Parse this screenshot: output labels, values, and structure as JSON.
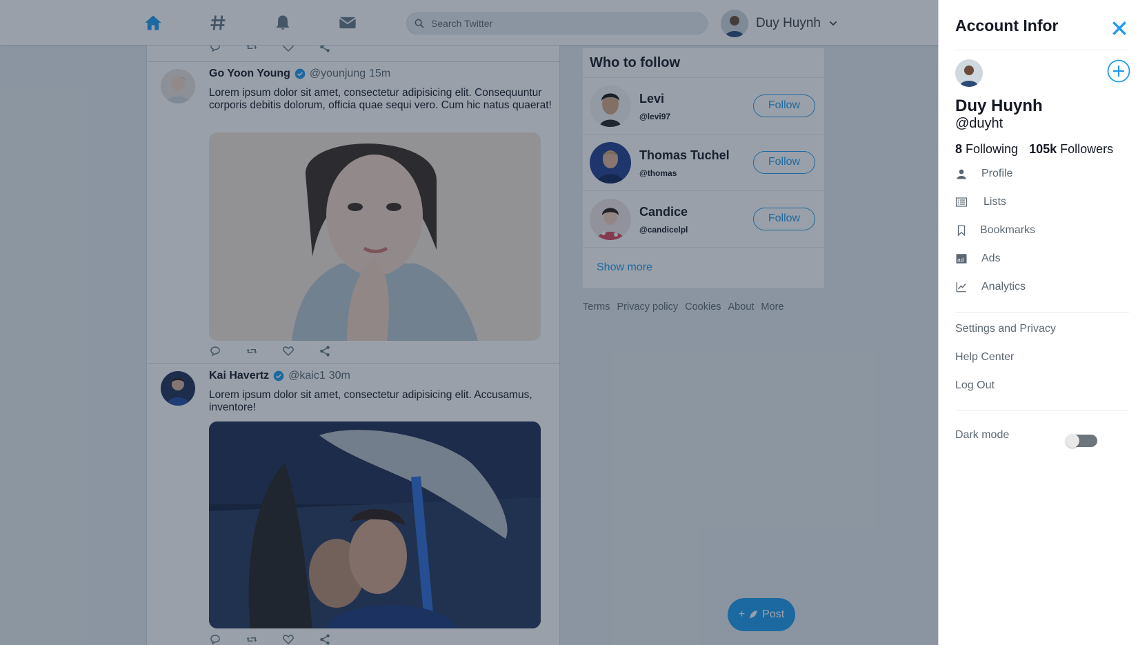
{
  "topbar": {
    "search_placeholder": "Search Twitter",
    "user_name": "Duy Huynh"
  },
  "feed": {
    "tweets": [
      {
        "name": "Go Yoon Young",
        "handle": "@younjung",
        "time": "15m",
        "text": "Lorem ipsum dolor sit amet, consectetur adipisicing elit. Consequuntur corporis debitis dolorum, officia quae sequi vero. Cum hic natus quaerat!"
      },
      {
        "name": "Kai Havertz",
        "handle": "@kaic1",
        "time": "30m",
        "text": "Lorem ipsum dolor sit amet, consectetur adipisicing elit. Accusamus, inventore!"
      }
    ]
  },
  "who_to_follow": {
    "title": "Who to follow",
    "users": [
      {
        "name": "Levi",
        "handle": "@levi97",
        "button": "Follow"
      },
      {
        "name": "Thomas Tuchel",
        "handle": "@thomas",
        "button": "Follow"
      },
      {
        "name": "Candice",
        "handle": "@candicelpl",
        "button": "Follow"
      }
    ],
    "show_more": "Show more"
  },
  "footer_links": [
    "Terms",
    "Privacy policy",
    "Cookies",
    "About",
    "More"
  ],
  "post_button": {
    "icon": "+",
    "label": "Post"
  },
  "account_panel": {
    "title": "Account Infor",
    "name": "Duy Huynh",
    "handle": "@duyht",
    "following_count": "8",
    "following_label": "Following",
    "followers_count": "105k",
    "followers_label": "Followers",
    "menu": [
      {
        "label": "Profile",
        "icon": "person-icon"
      },
      {
        "label": "Lists",
        "icon": "list-icon"
      },
      {
        "label": "Bookmarks",
        "icon": "bookmark-icon"
      },
      {
        "label": "Ads",
        "icon": "ads-icon"
      },
      {
        "label": "Analytics",
        "icon": "analytics-icon"
      }
    ],
    "secondary": [
      "Settings and Privacy",
      "Help Center",
      "Log Out"
    ],
    "dark_mode_label": "Dark mode",
    "dark_mode_on": false
  },
  "colors": {
    "accent": "#1d9bf0",
    "overlay": "#1c2d40"
  }
}
